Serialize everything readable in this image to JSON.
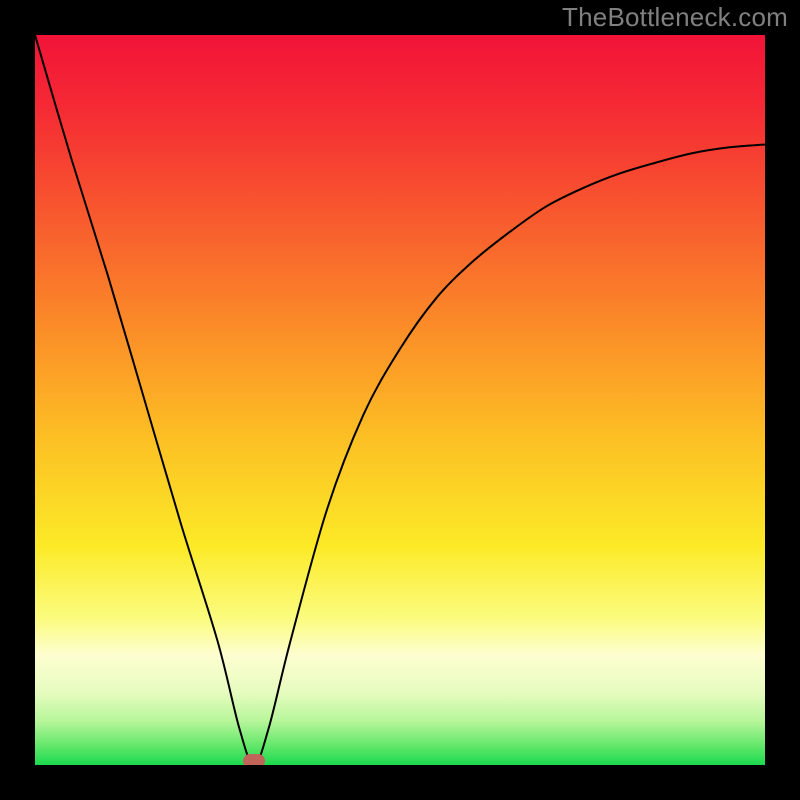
{
  "watermark": "TheBottleneck.com",
  "chart_data": {
    "type": "line",
    "title": "",
    "xlabel": "",
    "ylabel": "",
    "xlim": [
      0,
      100
    ],
    "ylim": [
      0,
      100
    ],
    "grid": false,
    "series": [
      {
        "name": "bottleneck-curve",
        "x": [
          0,
          5,
          10,
          15,
          20,
          25,
          28,
          30,
          32,
          35,
          40,
          45,
          50,
          55,
          60,
          65,
          70,
          75,
          80,
          85,
          90,
          95,
          100
        ],
        "values": [
          100,
          83,
          67,
          50,
          33,
          17,
          5,
          0,
          5,
          17,
          35,
          48,
          57,
          64,
          69,
          73,
          76.5,
          79,
          81,
          82.5,
          83.8,
          84.6,
          85
        ]
      }
    ],
    "annotations": [
      {
        "name": "optimal-marker",
        "x": 30,
        "y": 0.6,
        "color": "#c1645a"
      }
    ],
    "gradient_stops": [
      {
        "offset": 0,
        "color": "#f21338"
      },
      {
        "offset": 0.1,
        "color": "#f52a34"
      },
      {
        "offset": 0.25,
        "color": "#f85a2e"
      },
      {
        "offset": 0.4,
        "color": "#fb8c28"
      },
      {
        "offset": 0.55,
        "color": "#fcbf24"
      },
      {
        "offset": 0.7,
        "color": "#fcea27"
      },
      {
        "offset": 0.8,
        "color": "#fbfc80"
      },
      {
        "offset": 0.85,
        "color": "#fdfed0"
      },
      {
        "offset": 0.9,
        "color": "#e7fcc0"
      },
      {
        "offset": 0.94,
        "color": "#b6f69a"
      },
      {
        "offset": 0.97,
        "color": "#6ce96f"
      },
      {
        "offset": 1.0,
        "color": "#1bd94e"
      }
    ]
  }
}
